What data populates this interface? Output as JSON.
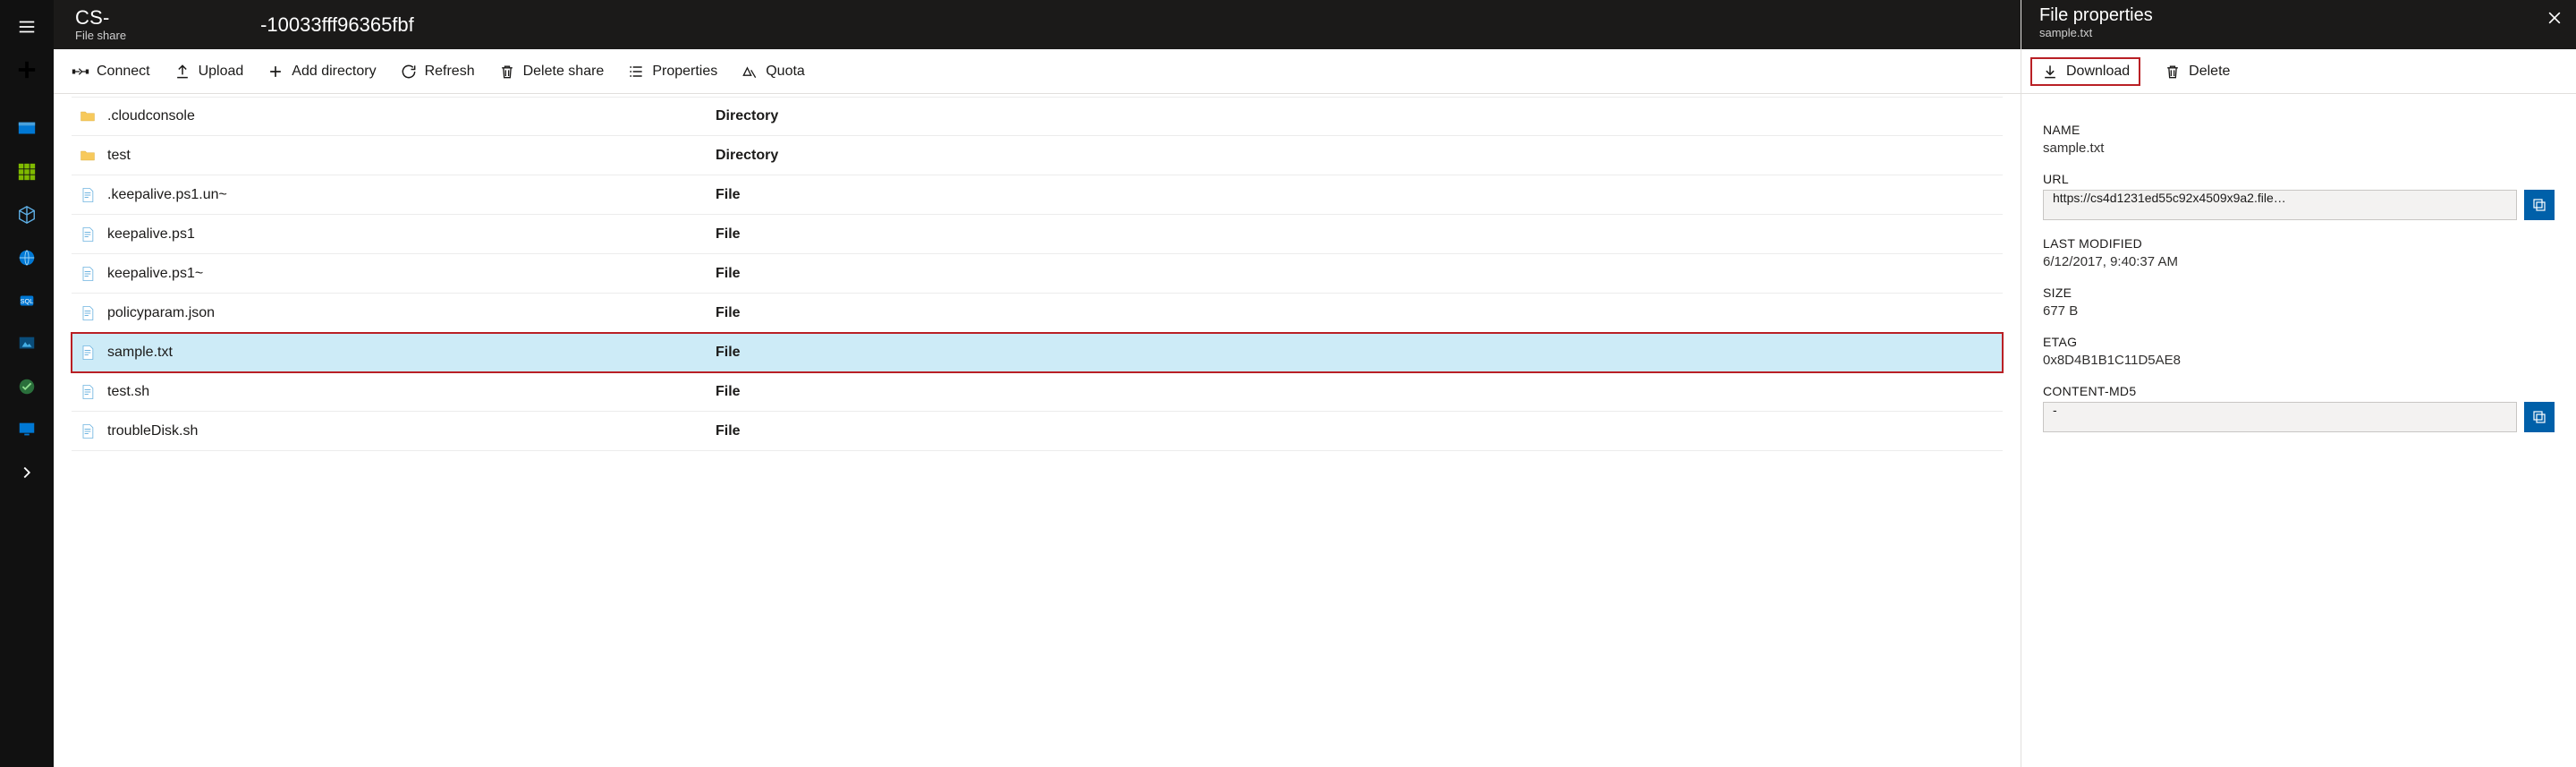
{
  "leftbar": {
    "items": [
      "menu",
      "plus",
      "dashboard",
      "grid",
      "cube",
      "globe",
      "sqlvm",
      "armtpl",
      "mgmt",
      "monitor",
      "chevron"
    ]
  },
  "header": {
    "title": "CS-",
    "title_suffix": "-10033fff96365fbf",
    "subtitle": "File share"
  },
  "toolbar": {
    "connect": "Connect",
    "upload": "Upload",
    "add_directory": "Add directory",
    "refresh": "Refresh",
    "delete_share": "Delete share",
    "properties": "Properties",
    "quota": "Quota"
  },
  "files": [
    {
      "icon": "folder",
      "name": ".cloudconsole",
      "type": "Directory",
      "selected": false
    },
    {
      "icon": "folder",
      "name": "test",
      "type": "Directory",
      "selected": false
    },
    {
      "icon": "file",
      "name": ".keepalive.ps1.un~",
      "type": "File",
      "selected": false
    },
    {
      "icon": "file",
      "name": "keepalive.ps1",
      "type": "File",
      "selected": false
    },
    {
      "icon": "file",
      "name": "keepalive.ps1~",
      "type": "File",
      "selected": false
    },
    {
      "icon": "file",
      "name": "policyparam.json",
      "type": "File",
      "selected": false
    },
    {
      "icon": "file",
      "name": "sample.txt",
      "type": "File",
      "selected": true
    },
    {
      "icon": "file",
      "name": "test.sh",
      "type": "File",
      "selected": false
    },
    {
      "icon": "file",
      "name": "troubleDisk.sh",
      "type": "File",
      "selected": false
    }
  ],
  "rightpane": {
    "title": "File properties",
    "subtitle": "sample.txt",
    "download": "Download",
    "delete": "Delete",
    "labels": {
      "name": "NAME",
      "url": "URL",
      "last_modified": "LAST MODIFIED",
      "size": "SIZE",
      "etag": "ETAG",
      "md5": "CONTENT-MD5"
    },
    "values": {
      "name": "sample.txt",
      "url": "https://cs4d1231ed55c92x4509x9a2.file…",
      "last_modified": "6/12/2017, 9:40:37 AM",
      "size": "677 B",
      "etag": "0x8D4B1B1C11D5AE8",
      "md5": "-"
    }
  }
}
